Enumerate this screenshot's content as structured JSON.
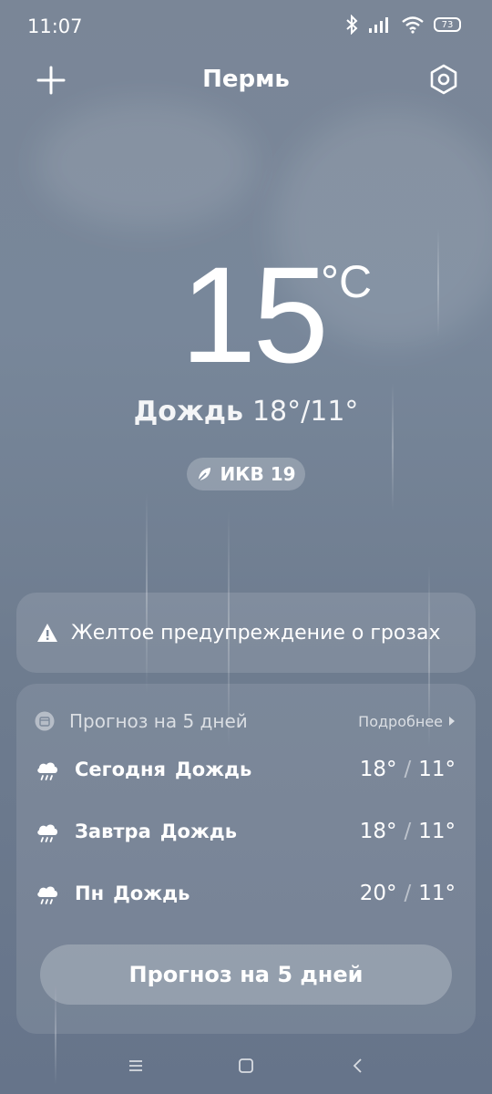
{
  "status_bar": {
    "time": "11:07",
    "battery": "73"
  },
  "header": {
    "city": "Пермь"
  },
  "current": {
    "temperature": "15",
    "unit": "°C",
    "condition": "Дождь",
    "range": "18°/11°",
    "aqi_label": "ИКВ 19"
  },
  "warning": {
    "text": "Желтое предупреждение о грозах"
  },
  "forecast": {
    "title": "Прогноз на 5 дней",
    "more_label": "Подробнее",
    "rows": [
      {
        "day": "Сегодня",
        "condition": "Дождь",
        "high": "18°",
        "low": "11°"
      },
      {
        "day": "Завтра",
        "condition": "Дождь",
        "high": "18°",
        "low": "11°"
      },
      {
        "day": "Пн",
        "condition": "Дождь",
        "high": "20°",
        "low": "11°"
      }
    ],
    "button_label": "Прогноз на 5 дней"
  },
  "separator": "/",
  "icons": {
    "add": "plus-icon",
    "settings": "settings-hex-icon",
    "bluetooth": "bluetooth-icon",
    "signal": "signal-icon",
    "wifi": "wifi-icon",
    "leaf": "leaf-icon",
    "warning": "warning-triangle-icon",
    "calendar": "calendar-icon",
    "rain": "rain-cloud-icon",
    "nav_menu": "menu-icon",
    "nav_home": "home-square-icon",
    "nav_back": "back-chevron-icon"
  }
}
